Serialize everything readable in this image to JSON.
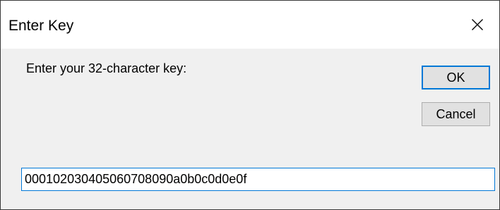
{
  "window": {
    "title": "Enter Key",
    "close_icon": "close-icon"
  },
  "dialog": {
    "prompt": "Enter your 32-character key:",
    "ok_label": "OK",
    "cancel_label": "Cancel",
    "key_value": "000102030405060708090a0b0c0d0e0f"
  },
  "colors": {
    "focus_accent": "#0078d7",
    "dialog_background": "#f0f0f0",
    "button_face": "#e1e1e1"
  }
}
